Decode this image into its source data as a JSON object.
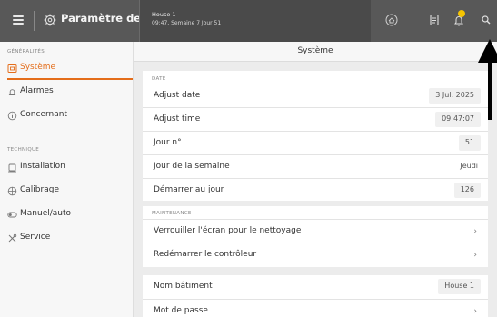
{
  "topbar": {
    "title": "Paramètre de base",
    "house_name": "House 1",
    "house_time": "09:47, Semaine 7 Jour 51"
  },
  "sidebar": {
    "general_label": "GÉNÉRALITÉS",
    "technical_label": "TECHNIQUE",
    "items": [
      {
        "label": "Système"
      },
      {
        "label": "Alarmes"
      },
      {
        "label": "Concernant"
      },
      {
        "label": "Installation"
      },
      {
        "label": "Calibrage"
      },
      {
        "label": "Manuel/auto"
      },
      {
        "label": "Service"
      }
    ]
  },
  "main": {
    "title": "Système",
    "date_group": "DATE",
    "maintenance_group": "MAINTENANCE",
    "rows": {
      "adjust_date": {
        "label": "Adjust date",
        "value": "3 Jul. 2025"
      },
      "adjust_time": {
        "label": "Adjust time",
        "value": "09:47:07"
      },
      "jour_n": {
        "label": "Jour n°",
        "value": "51"
      },
      "jour_semaine": {
        "label": "Jour de la semaine",
        "value": "Jeudi"
      },
      "demarrer": {
        "label": "Démarrer au jour",
        "value": "126"
      },
      "verrouiller": {
        "label": "Verrouiller l'écran pour le nettoyage"
      },
      "redemarrer": {
        "label": "Redémarrer le contrôleur"
      },
      "nom_batiment": {
        "label": "Nom bâtiment",
        "value": "House 1"
      },
      "mot_de_passe": {
        "label": "Mot de passe"
      }
    },
    "chevron": "›"
  },
  "colors": {
    "accent": "#e46d1a",
    "topbar": "#585858",
    "badge": "#f5c400"
  }
}
